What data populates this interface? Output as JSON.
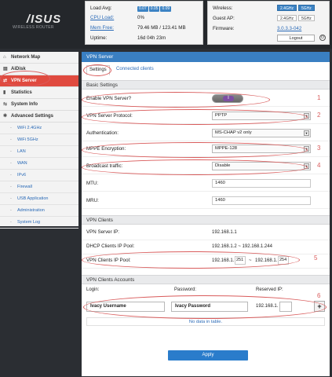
{
  "header": {
    "logo_text": "/ISUS",
    "logo_sub": "WIRELESS ROUTER",
    "stats_left": [
      {
        "label": "Load Avg:",
        "link": false,
        "badges": [
          "0.07",
          "0.05",
          "0.09"
        ]
      },
      {
        "label": "CPU Load:",
        "link": true,
        "value": "0%"
      },
      {
        "label": "Mem Free:",
        "link": true,
        "value": "79.46 MB / 123.41 MB"
      },
      {
        "label": "Uptime:",
        "link": false,
        "value": "16d 04h 23m"
      }
    ],
    "stats_right": {
      "wireless_label": "Wireless:",
      "guest_label": "Guest AP:",
      "firmware_label": "Firmware:",
      "band_24": "2.4GHz",
      "band_5": "5GHz",
      "firmware_value": "3.0.3.3-042",
      "logout_label": "Logout"
    }
  },
  "sidebar": {
    "items": [
      {
        "label": "Network Map",
        "icon": "home-icon"
      },
      {
        "label": "AiDisk",
        "icon": "disk-icon"
      },
      {
        "label": "VPN Server",
        "icon": "vpn-icon"
      },
      {
        "label": "Statistics",
        "icon": "stats-icon"
      },
      {
        "label": "System Info",
        "icon": "info-icon"
      },
      {
        "label": "Advanced Settings",
        "icon": "gear-icon"
      }
    ],
    "subitems": [
      "WiFi 2.4GHz",
      "WiFi 5GHz",
      "LAN",
      "WAN",
      "IPv6",
      "Firewall",
      "USB Application",
      "Administration",
      "System Log"
    ]
  },
  "main": {
    "title": "VPN Server",
    "tabs": {
      "settings": "Settings",
      "connected": "Connected clients"
    },
    "basic": {
      "heading": "Basic Settings",
      "enable_label": "Enable VPN Server?",
      "toggle_symbol": "I",
      "protocol_label": "VPN Server Protocol:",
      "protocol_value": "PPTP",
      "auth_label": "Authentication:",
      "auth_value": "MS-CHAP v2 only",
      "mppe_label": "MPPE Encryption:",
      "mppe_value": "MPPE-128",
      "broadcast_label": "Broadcast traffic:",
      "broadcast_value": "Disable",
      "mtu_label": "MTU:",
      "mtu_value": "1460",
      "mru_label": "MRU:",
      "mru_value": "1460"
    },
    "clients": {
      "heading": "VPN Clients",
      "server_ip_label": "VPN Server IP:",
      "server_ip_value": "192.168.1.1",
      "dhcp_label": "DHCP Clients IP Pool:",
      "dhcp_value": "192.168.1.2 ~ 192.168.1.244",
      "pool_label": "VPN Clients IP Pool:",
      "pool_prefix_start": "192.168.1.",
      "pool_start": "251",
      "pool_sep": "~",
      "pool_prefix_end": "192.168.1.",
      "pool_end": "254"
    },
    "accounts": {
      "heading": "VPN Clients Accounts",
      "login_header": "Login:",
      "password_header": "Password:",
      "reserved_header": "Reserved IP:",
      "login_value": "Ivacy Username",
      "password_value": "Ivacy Password",
      "reserved_prefix": "192.168.1.",
      "reserved_value": "",
      "add_symbol": "+",
      "no_data": "No data in table."
    },
    "apply_label": "Apply"
  },
  "annotations": {
    "numbers": [
      "1",
      "2",
      "3",
      "4",
      "5",
      "6"
    ],
    "color": "#d95c5c"
  }
}
